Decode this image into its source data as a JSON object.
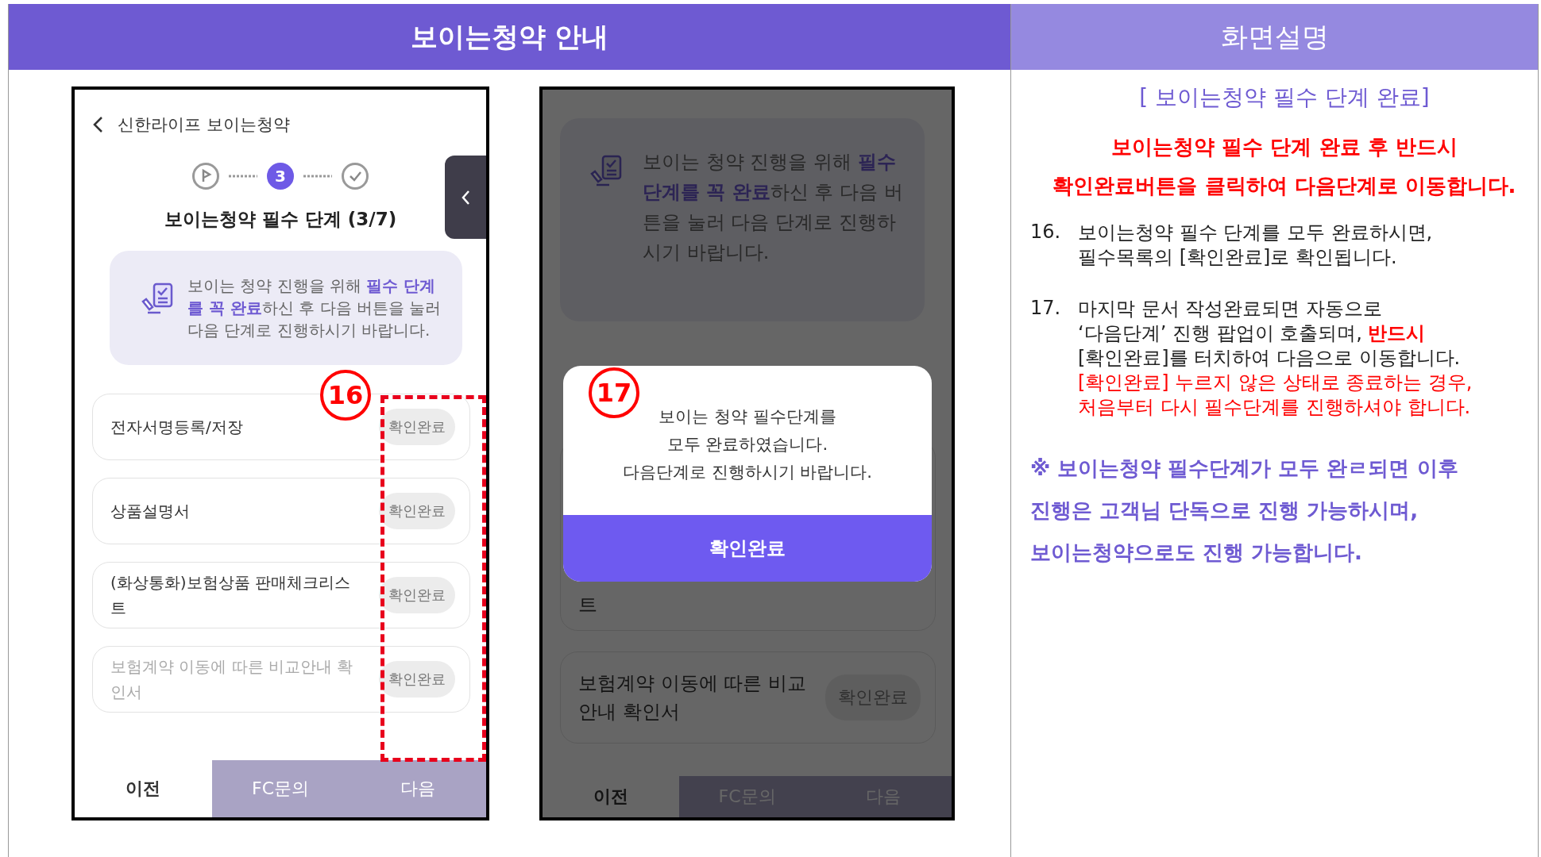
{
  "header": {
    "title": "보이는청약 안내",
    "side_title": "화면설명"
  },
  "phone_main": {
    "app_title": "신한라이프 보이는청약",
    "steps": [
      {
        "kind": "start",
        "selected": false
      },
      {
        "kind": "number",
        "label": "3",
        "selected": true
      },
      {
        "kind": "done",
        "selected": false
      }
    ],
    "step_title": "보이는청약 필수 단계 (3/7)",
    "notice": "보이는 청약 진행을 위해 **필수 단계를 꼭 완료**하신 후 다음 버튼을 눌러 다음 단계로 진행하시기 바랍니다.",
    "marker": "16",
    "items": [
      {
        "label": "전자서명등록/저장",
        "badge": "확인완료",
        "faded": false
      },
      {
        "label": "상품설명서",
        "badge": "확인완료",
        "faded": false
      },
      {
        "label": "(화상통화)보험상품 판매체크리스트",
        "badge": "확인완료",
        "faded": false
      },
      {
        "label": "보험계약 이동에 따른 비교안내 확인서",
        "badge": "확인완료",
        "faded": true
      }
    ],
    "tabs": [
      {
        "label": "이전",
        "kind": "secondary"
      },
      {
        "label": "FC문의",
        "kind": "primary"
      },
      {
        "label": "다음",
        "kind": "primary"
      }
    ]
  },
  "phone_popup": {
    "notice": "보이는 청약 진행을 위해 **필수 단계를 꼭 완료**하신 후 다음 버튼을 눌러 다음 단계로 진행하시기 바랍니다.",
    "items": [
      {
        "label": "트"
      },
      {
        "label": "보험계약 이동에 따른 비교안내 확인서",
        "badge": "확인완료"
      }
    ],
    "tabs": [
      {
        "label": "이전",
        "kind": "secondary"
      },
      {
        "label": "FC문의",
        "kind": "primary"
      },
      {
        "label": "다음",
        "kind": "primary"
      }
    ],
    "popup": {
      "marker": "17",
      "message_lines": [
        "보이는 청약 필수단계를",
        "모두 완료하였습니다.",
        "다음단계로 진행하시기 바랍니다."
      ],
      "button": "확인완료"
    }
  },
  "description": {
    "heading": "[ 보이는청약 필수 단계 완료]",
    "warning_lines": [
      "보이는청약 필수 단계 완료 후 반드시",
      "확인완료버튼을 클릭하여 다음단계로 이동합니다."
    ],
    "steps": [
      {
        "number": "16.",
        "lines": [
          {
            "kind": "normal",
            "text": "보이는청약 필수 단계를 모두 완료하시면,"
          },
          {
            "kind": "normal",
            "text": "필수목록의 [확인완료]로 확인됩니다."
          }
        ]
      },
      {
        "number": "17.",
        "lines": [
          {
            "kind": "normal",
            "text": "마지막 문서 작성완료되면 자동으로"
          },
          {
            "kind": "normal",
            "text": "‘다음단계’ 진행 팝업이 호출되며, **반드시**"
          },
          {
            "kind": "normal",
            "text": "[확인완료]를 터치하여 다음으로 이동합니다."
          },
          {
            "kind": "warning",
            "text": "[확인완료] 누르지 않은 상태로 종료하는 경우,"
          },
          {
            "kind": "warning",
            "text": "처음부터 다시 필수단계를 진행하셔야 합니다."
          }
        ]
      }
    ],
    "footnote_lines": [
      "※ 보이는청약 필수단계가 모두 완ㄹ되면 이후",
      "진행은 고객님 단독으로 진행 가능하시며,",
      "보이는청약으로도 진행 가능합니다."
    ]
  }
}
